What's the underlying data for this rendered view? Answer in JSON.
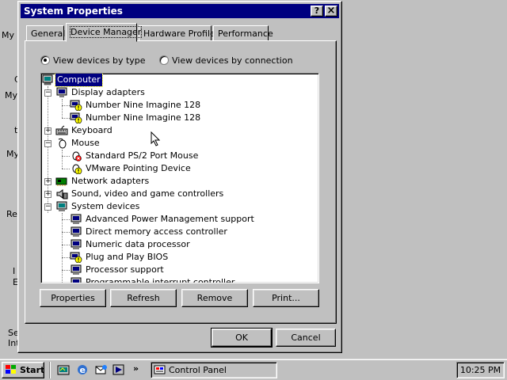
{
  "desktop": {
    "labels": [
      "My D",
      "C",
      "My",
      "t",
      "My",
      "Re",
      "I",
      "E",
      "Se",
      "Int"
    ]
  },
  "window": {
    "title": "System Properties",
    "help_label": "?",
    "close_label": "×"
  },
  "tabs": [
    {
      "label": "General",
      "active": false
    },
    {
      "label": "Device Manager",
      "active": true
    },
    {
      "label": "Hardware Profiles",
      "active": false
    },
    {
      "label": "Performance",
      "active": false
    }
  ],
  "view_options": {
    "by_type": "View devices by type",
    "by_connection": "View devices by connection",
    "selected": "by_type"
  },
  "tree": {
    "items": [
      {
        "label": "Computer",
        "level": 0,
        "icon": "computer-icon",
        "selected": true
      },
      {
        "label": "Display adapters",
        "level": 1,
        "icon": "monitor-icon",
        "expander": "−"
      },
      {
        "label": "Number Nine Imagine 128",
        "level": 2,
        "icon": "display-warning-icon"
      },
      {
        "label": "Number Nine Imagine 128",
        "level": 2,
        "icon": "display-warning-icon"
      },
      {
        "label": "Keyboard",
        "level": 1,
        "icon": "keyboard-icon",
        "expander": "+"
      },
      {
        "label": "Mouse",
        "level": 1,
        "icon": "mouse-icon",
        "expander": "−"
      },
      {
        "label": "Standard PS/2 Port Mouse",
        "level": 2,
        "icon": "mouse-disabled-icon"
      },
      {
        "label": "VMware Pointing Device",
        "level": 2,
        "icon": "mouse-warning-icon"
      },
      {
        "label": "Network adapters",
        "level": 1,
        "icon": "network-icon",
        "expander": "+"
      },
      {
        "label": "Sound, video and game controllers",
        "level": 1,
        "icon": "sound-icon",
        "expander": "+"
      },
      {
        "label": "System devices",
        "level": 1,
        "icon": "system-icon",
        "expander": "−"
      },
      {
        "label": "Advanced Power Management support",
        "level": 2,
        "icon": "system-device-icon"
      },
      {
        "label": "Direct memory access controller",
        "level": 2,
        "icon": "system-device-icon"
      },
      {
        "label": "Numeric data processor",
        "level": 2,
        "icon": "system-device-icon"
      },
      {
        "label": "Plug and Play BIOS",
        "level": 2,
        "icon": "system-device-warning-icon"
      },
      {
        "label": "Processor support",
        "level": 2,
        "icon": "system-device-icon"
      },
      {
        "label": "Programmable interrupt controller",
        "level": 2,
        "icon": "system-device-icon"
      }
    ]
  },
  "action_buttons": {
    "properties": "Properties",
    "refresh": "Refresh",
    "remove": "Remove",
    "print": "Print..."
  },
  "dialog_buttons": {
    "ok": "OK",
    "cancel": "Cancel"
  },
  "taskbar": {
    "start_label": "Start",
    "quick_launch_more": "»",
    "task_label": "Control Panel",
    "clock": "10:25 PM"
  },
  "colors": {
    "face": "#c0c0c0",
    "title_bar": "#000080",
    "selection": "#000080",
    "warning": "#ffff00"
  }
}
